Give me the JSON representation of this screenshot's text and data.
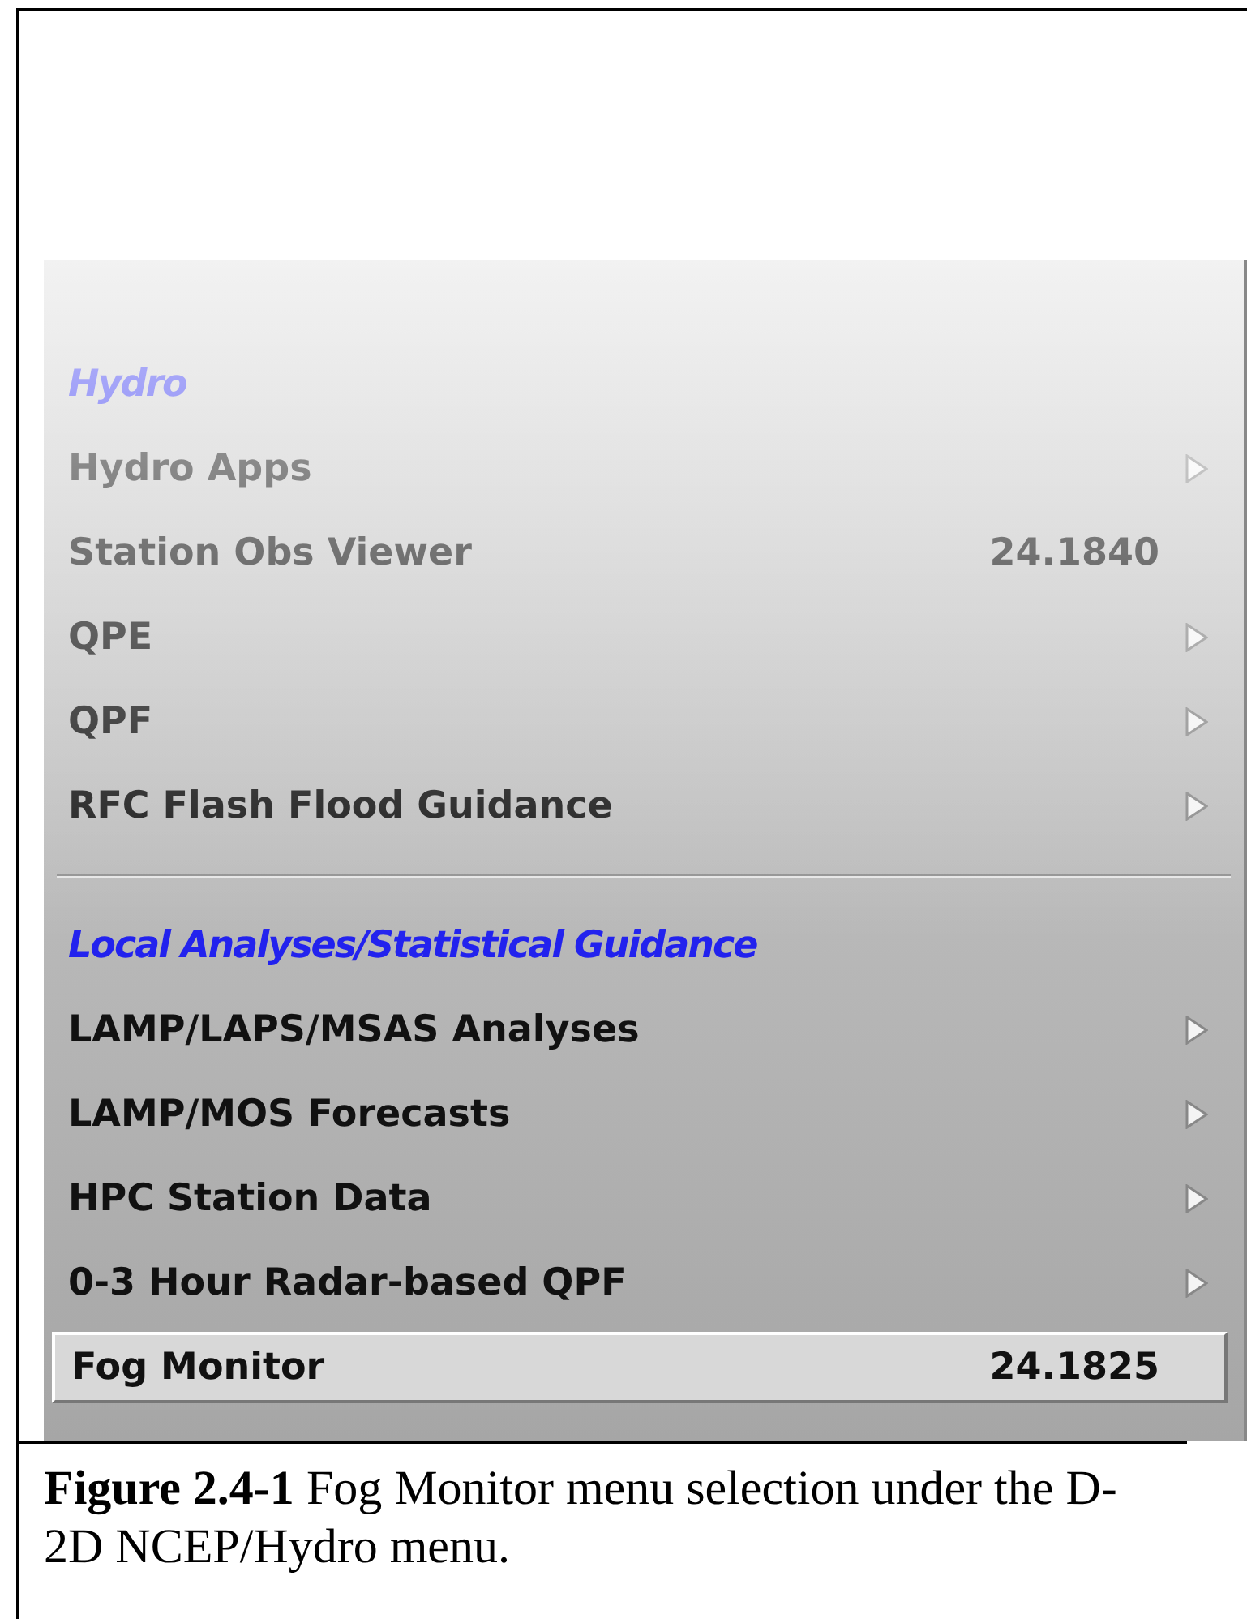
{
  "menu": {
    "items": [
      {
        "kind": "header",
        "label": "Hydro"
      },
      {
        "kind": "item",
        "label": "Hydro Apps",
        "submenu": true,
        "selected": false
      },
      {
        "kind": "item",
        "label": "Station Obs Viewer",
        "shortcut": "24.1840",
        "submenu": false,
        "selected": false
      },
      {
        "kind": "item",
        "label": "QPE",
        "submenu": true,
        "selected": false
      },
      {
        "kind": "item",
        "label": "QPF",
        "submenu": true,
        "selected": false
      },
      {
        "kind": "item",
        "label": "RFC Flash Flood Guidance",
        "submenu": true,
        "selected": false
      },
      {
        "kind": "separator"
      },
      {
        "kind": "header",
        "label": "Local Analyses/Statistical Guidance"
      },
      {
        "kind": "item",
        "label": "LAMP/LAPS/MSAS Analyses",
        "submenu": true,
        "selected": false
      },
      {
        "kind": "item",
        "label": "LAMP/MOS Forecasts",
        "submenu": true,
        "selected": false
      },
      {
        "kind": "item",
        "label": "HPC Station Data",
        "submenu": true,
        "selected": false
      },
      {
        "kind": "item",
        "label": "0-3 Hour Radar-based QPF",
        "submenu": true,
        "selected": false
      },
      {
        "kind": "item",
        "label": "Fog Monitor",
        "shortcut": "24.1825",
        "submenu": false,
        "selected": true
      }
    ]
  },
  "caption": "**Figure 2.4-1** Fog Monitor menu selection under the D-2D NCEP/Hydro menu."
}
